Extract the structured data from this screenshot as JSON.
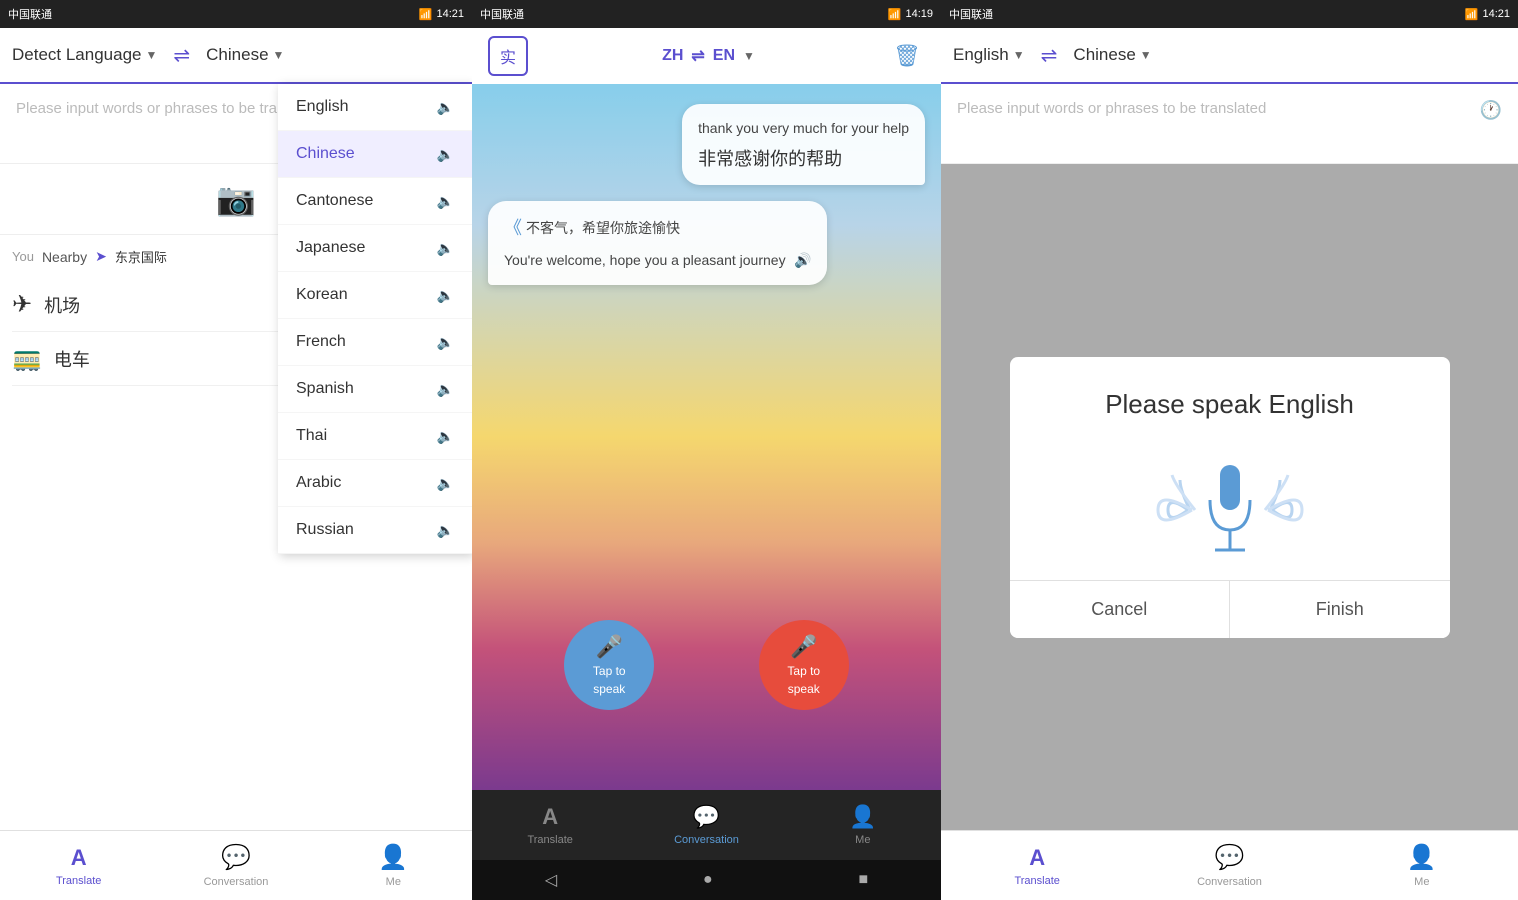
{
  "screen1": {
    "status": {
      "carrier": "中国联通",
      "time": "14:21",
      "signal": "3G"
    },
    "nav": {
      "detect_language": "Detect Language",
      "target_language": "Chinese",
      "swap_symbol": "⇌"
    },
    "input_placeholder": "Please input words or phrases to be translated",
    "dropdown": {
      "items": [
        {
          "label": "English",
          "active": false
        },
        {
          "label": "Chinese",
          "active": true
        },
        {
          "label": "Cantonese",
          "active": false
        },
        {
          "label": "Japanese",
          "active": false
        },
        {
          "label": "Korean",
          "active": false
        },
        {
          "label": "French",
          "active": false
        },
        {
          "label": "Spanish",
          "active": false
        },
        {
          "label": "Thai",
          "active": false
        },
        {
          "label": "Arabic",
          "active": false
        },
        {
          "label": "Russian",
          "active": false
        }
      ]
    },
    "nearby": {
      "you_label": "You",
      "nearby_label": "Nearby",
      "location": "东京国际",
      "items": [
        {
          "icon": "✈",
          "text": "机场"
        },
        {
          "icon": "🚃",
          "text": "电车"
        }
      ]
    },
    "tabs": [
      {
        "label": "Translate",
        "active": true,
        "icon": "A"
      },
      {
        "label": "Conversation",
        "active": false,
        "icon": "💬"
      },
      {
        "label": "Me",
        "active": false,
        "icon": "👤"
      }
    ]
  },
  "screen2": {
    "status": {
      "carrier": "中国联通",
      "time": "14:19"
    },
    "nav": {
      "real_btn": "实",
      "zh": "ZH",
      "arrows": "⇌",
      "en": "EN"
    },
    "messages": [
      {
        "side": "right",
        "english": "thank you very much for your help",
        "chinese": "非常感谢你的帮助"
      },
      {
        "side": "left",
        "chinese": "不客气，希望你旅途愉快",
        "english": "You're welcome, hope you a pleasant journey"
      }
    ],
    "speak_buttons": [
      {
        "label": "Tap to speak",
        "color": "blue"
      },
      {
        "label": "Tap to speak",
        "color": "red"
      }
    ],
    "tabs": [
      {
        "label": "Translate",
        "active": false,
        "icon": "A"
      },
      {
        "label": "Conversation",
        "active": true,
        "icon": "💬"
      },
      {
        "label": "Me",
        "active": false,
        "icon": "👤"
      }
    ],
    "android_nav": [
      "◁",
      "●",
      "■"
    ]
  },
  "screen3": {
    "status": {
      "carrier": "中国联通",
      "time": "14:21"
    },
    "nav": {
      "source_language": "English",
      "target_language": "Chinese",
      "swap_symbol": "⇌"
    },
    "input_placeholder": "Please input words or phrases to be translated",
    "dialog": {
      "title": "Please speak English",
      "cancel": "Cancel",
      "finish": "Finish"
    },
    "tabs": [
      {
        "label": "Translate",
        "active": true,
        "icon": "A"
      },
      {
        "label": "Conversation",
        "active": false,
        "icon": "💬"
      },
      {
        "label": "Me",
        "active": false,
        "icon": "👤"
      }
    ]
  }
}
